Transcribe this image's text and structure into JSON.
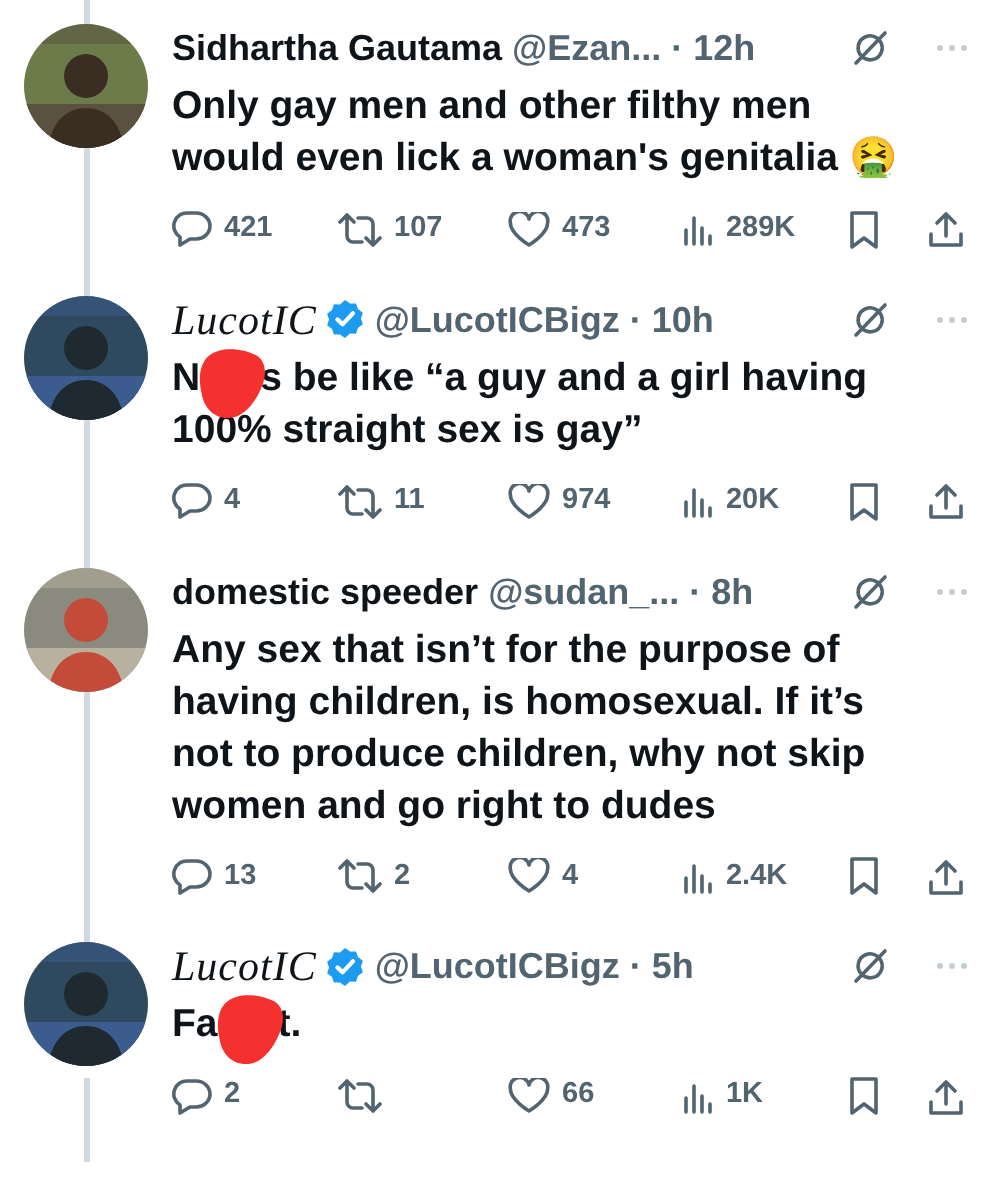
{
  "tweets": [
    {
      "display_name": "Sidhartha Gautama",
      "kind": "plain",
      "verified": false,
      "handle": "@Ezan...",
      "separator": "·",
      "time": "12h",
      "body": [
        [
          {
            "kind": "text",
            "text": "Only gay men and other filthy men would even lick a woman's genitalia 🤮"
          }
        ]
      ],
      "replies": "421",
      "retweets": "107",
      "likes": "473",
      "views": "289K"
    },
    {
      "display_name": "LucotIC",
      "kind": "script",
      "verified": true,
      "handle": "@LucotICBigz",
      "separator": "·",
      "time": "10h",
      "body": [
        [
          {
            "kind": "text",
            "text": "N"
          },
          {
            "kind": "redaction"
          },
          {
            "kind": "text",
            "text": "s be like “a guy and a girl having"
          }
        ],
        [
          {
            "kind": "text",
            "text": "100% straight sex is gay”"
          }
        ]
      ],
      "replies": "4",
      "retweets": "11",
      "likes": "974",
      "views": "20K"
    },
    {
      "display_name": "domestic speeder",
      "kind": "plain",
      "verified": false,
      "handle": "@sudan_...",
      "separator": "·",
      "time": "8h",
      "body": [
        [
          {
            "kind": "text",
            "text": "Any sex that isn’t for the purpose of having children, is homosexual. If it’s not to produce children, why not skip women and go right to dudes"
          }
        ]
      ],
      "replies": "13",
      "retweets": "2",
      "likes": "4",
      "views": "2.4K"
    },
    {
      "display_name": "LucotIC",
      "kind": "script",
      "verified": true,
      "handle": "@LucotICBigz",
      "separator": "·",
      "time": "5h",
      "body": [
        [
          {
            "kind": "text",
            "text": "Fa"
          },
          {
            "kind": "redaction"
          },
          {
            "kind": "text",
            "text": "t."
          }
        ]
      ],
      "replies": "2",
      "likes": "66",
      "views": "1K"
    }
  ]
}
